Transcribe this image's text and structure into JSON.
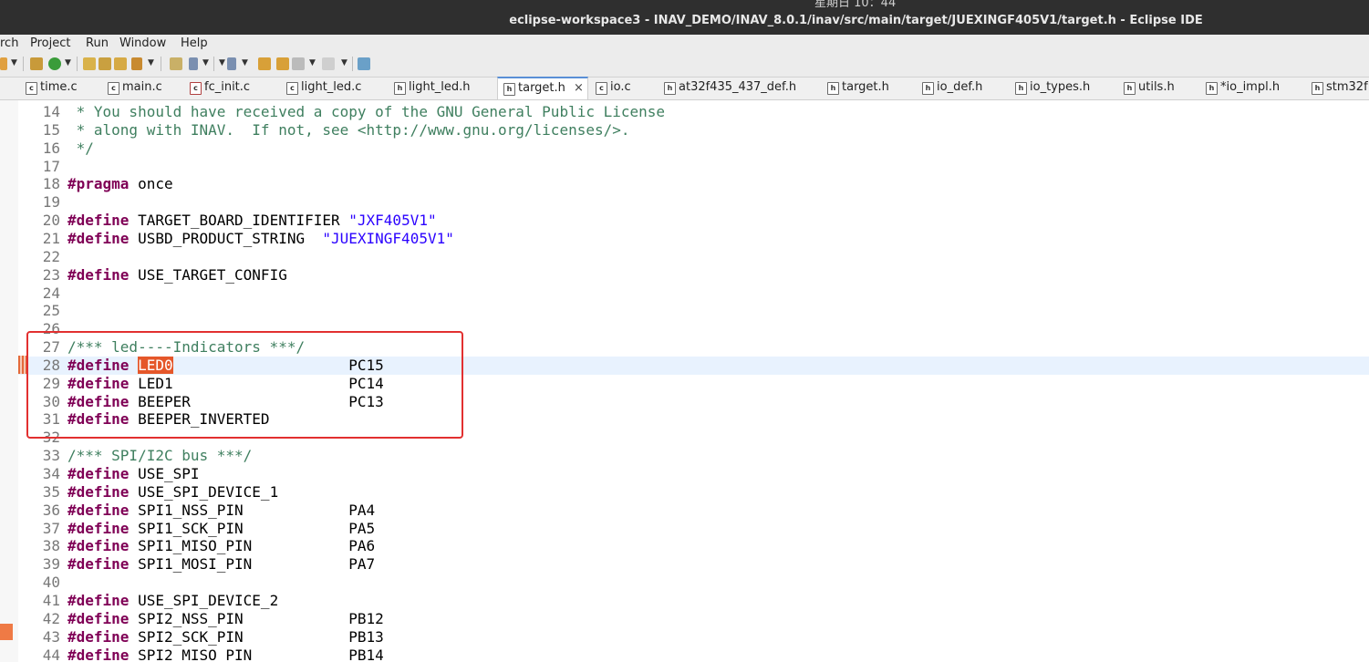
{
  "system": {
    "clock": "星期日 10：44"
  },
  "window": {
    "title": "eclipse-workspace3 - INAV_DEMO/INAV_8.0.1/inav/src/main/target/JUEXINGF405V1/target.h - Eclipse IDE"
  },
  "menu": [
    "rch",
    "Project",
    "Run",
    "Window",
    "Help"
  ],
  "tabs": [
    {
      "label": "time.c",
      "icon": "c-file-icon"
    },
    {
      "label": "main.c",
      "icon": "c-file-icon"
    },
    {
      "label": "fc_init.c",
      "icon": "c-file-error-icon"
    },
    {
      "label": "light_led.c",
      "icon": "c-file-icon"
    },
    {
      "label": "light_led.h",
      "icon": "h-file-icon"
    },
    {
      "label": "target.h",
      "icon": "h-file-icon",
      "active": true
    },
    {
      "label": "io.c",
      "icon": "c-file-icon"
    },
    {
      "label": "at32f435_437_def.h",
      "icon": "h-file-icon"
    },
    {
      "label": "target.h",
      "icon": "h-file-icon"
    },
    {
      "label": "io_def.h",
      "icon": "h-file-icon"
    },
    {
      "label": "io_types.h",
      "icon": "h-file-icon"
    },
    {
      "label": "utils.h",
      "icon": "h-file-icon"
    },
    {
      "label": "*io_impl.h",
      "icon": "h-file-icon"
    },
    {
      "label": "stm32f",
      "icon": "h-file-icon"
    }
  ],
  "tab_close_glyph": "×",
  "code": [
    {
      "n": "14",
      "parts": [
        [
          "cmt",
          " * You should have received a copy of the GNU General Public License"
        ]
      ]
    },
    {
      "n": "15",
      "parts": [
        [
          "cmt",
          " * along with INAV.  If not, see <http://www.gnu.org/licenses/>."
        ]
      ]
    },
    {
      "n": "16",
      "parts": [
        [
          "cmt",
          " */"
        ]
      ]
    },
    {
      "n": "17",
      "parts": []
    },
    {
      "n": "18",
      "parts": [
        [
          "kw",
          "#pragma"
        ],
        [
          "",
          " once"
        ]
      ]
    },
    {
      "n": "19",
      "parts": []
    },
    {
      "n": "20",
      "parts": [
        [
          "kw",
          "#define"
        ],
        [
          "",
          " TARGET_BOARD_IDENTIFIER "
        ],
        [
          "str",
          "\"JXF405V1\""
        ]
      ]
    },
    {
      "n": "21",
      "parts": [
        [
          "kw",
          "#define"
        ],
        [
          "",
          " USBD_PRODUCT_STRING  "
        ],
        [
          "str",
          "\"JUEXINGF405V1\""
        ]
      ]
    },
    {
      "n": "22",
      "parts": []
    },
    {
      "n": "23",
      "parts": [
        [
          "kw",
          "#define"
        ],
        [
          "",
          " USE_TARGET_CONFIG"
        ]
      ]
    },
    {
      "n": "24",
      "parts": []
    },
    {
      "n": "25",
      "parts": []
    },
    {
      "n": "26",
      "parts": []
    },
    {
      "n": "27",
      "parts": [
        [
          "cmt",
          "/*** led----Indicators ***/"
        ]
      ]
    },
    {
      "n": "28",
      "current": true,
      "parts": [
        [
          "kw",
          "#define"
        ],
        [
          "",
          " "
        ],
        [
          "sel",
          "LED0"
        ],
        [
          "",
          "                    PC15"
        ]
      ]
    },
    {
      "n": "29",
      "parts": [
        [
          "kw",
          "#define"
        ],
        [
          "",
          " LED1                    PC14"
        ]
      ]
    },
    {
      "n": "30",
      "parts": [
        [
          "kw",
          "#define"
        ],
        [
          "",
          " BEEPER                  PC13"
        ]
      ]
    },
    {
      "n": "31",
      "parts": [
        [
          "kw",
          "#define"
        ],
        [
          "",
          " BEEPER_INVERTED"
        ]
      ]
    },
    {
      "n": "32",
      "parts": []
    },
    {
      "n": "33",
      "parts": [
        [
          "cmt",
          "/*** SPI/I2C bus ***/"
        ]
      ]
    },
    {
      "n": "34",
      "parts": [
        [
          "kw",
          "#define"
        ],
        [
          "",
          " USE_SPI"
        ]
      ]
    },
    {
      "n": "35",
      "parts": [
        [
          "kw",
          "#define"
        ],
        [
          "",
          " USE_SPI_DEVICE_1"
        ]
      ]
    },
    {
      "n": "36",
      "parts": [
        [
          "kw",
          "#define"
        ],
        [
          "",
          " SPI1_NSS_PIN            PA4"
        ]
      ]
    },
    {
      "n": "37",
      "parts": [
        [
          "kw",
          "#define"
        ],
        [
          "",
          " SPI1_SCK_PIN            PA5"
        ]
      ]
    },
    {
      "n": "38",
      "parts": [
        [
          "kw",
          "#define"
        ],
        [
          "",
          " SPI1_MISO_PIN           PA6"
        ]
      ]
    },
    {
      "n": "39",
      "parts": [
        [
          "kw",
          "#define"
        ],
        [
          "",
          " SPI1_MOSI_PIN           PA7"
        ]
      ]
    },
    {
      "n": "40",
      "parts": []
    },
    {
      "n": "41",
      "parts": [
        [
          "kw",
          "#define"
        ],
        [
          "",
          " USE_SPI_DEVICE_2"
        ]
      ]
    },
    {
      "n": "42",
      "parts": [
        [
          "kw",
          "#define"
        ],
        [
          "",
          " SPI2_NSS_PIN            PB12"
        ]
      ]
    },
    {
      "n": "43",
      "parts": [
        [
          "kw",
          "#define"
        ],
        [
          "",
          " SPI2_SCK_PIN            PB13"
        ]
      ]
    },
    {
      "n": "44",
      "parts": [
        [
          "kw",
          "#define"
        ],
        [
          "",
          " SPI2_MISO_PIN           PB14"
        ]
      ]
    }
  ]
}
